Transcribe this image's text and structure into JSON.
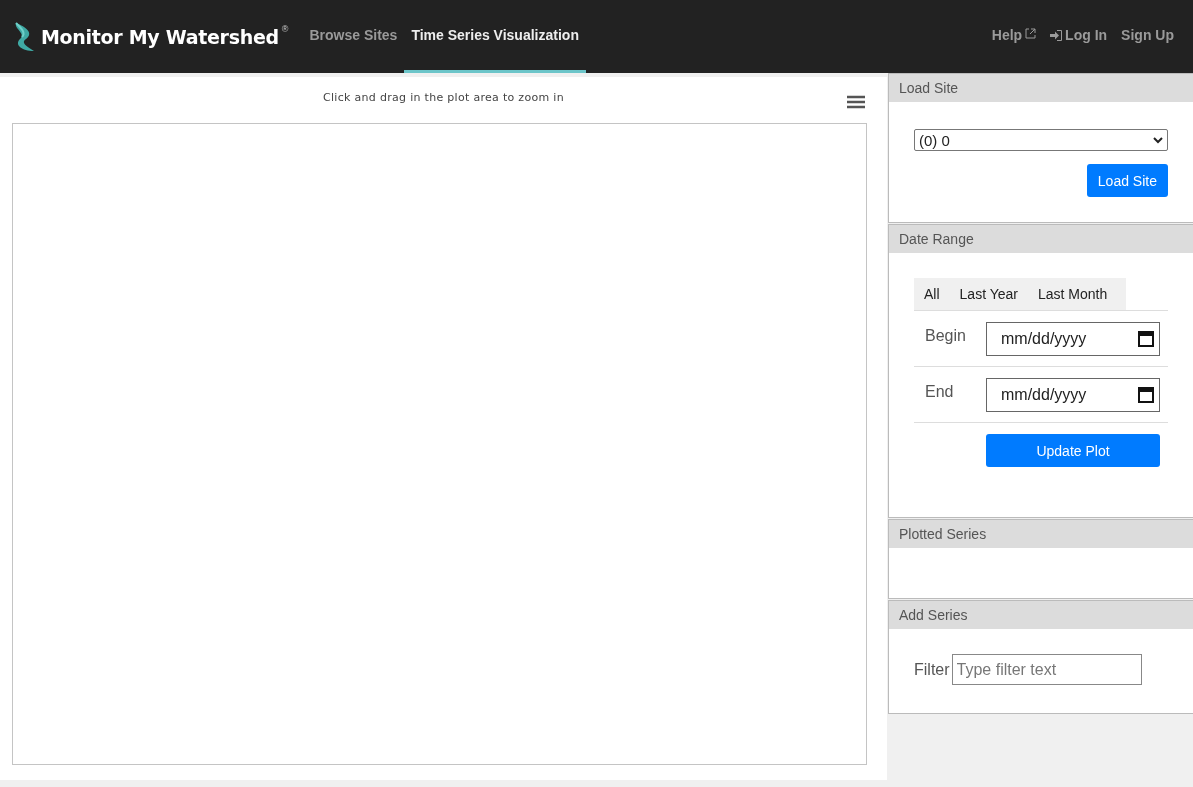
{
  "navbar": {
    "brand": "Monitor My Watershed",
    "brand_mark": "®",
    "links": [
      {
        "label": "Browse Sites",
        "selected": false
      },
      {
        "label": "Time Series Visualization",
        "selected": true
      }
    ],
    "right_links": [
      {
        "label": "Help",
        "kind": "external"
      },
      {
        "label": "Log In",
        "kind": "login"
      },
      {
        "label": "Sign Up",
        "kind": "plain"
      }
    ]
  },
  "plot": {
    "hint": "Click and drag in the plot area to zoom in"
  },
  "load_site": {
    "title": "Load Site",
    "site_value": "(0) 0",
    "button": "Load Site"
  },
  "date_range": {
    "title": "Date Range",
    "tabs": [
      "All",
      "Last Year",
      "Last Month"
    ],
    "fields": [
      {
        "label": "Begin",
        "placeholder": "mm/dd/yyyy"
      },
      {
        "label": "End",
        "placeholder": "mm/dd/yyyy"
      }
    ],
    "button": "Update Plot"
  },
  "plotted_series": {
    "title": "Plotted Series"
  },
  "add_series": {
    "title": "Add Series",
    "filter_label": "Filter",
    "filter_placeholder": "Type filter text"
  }
}
